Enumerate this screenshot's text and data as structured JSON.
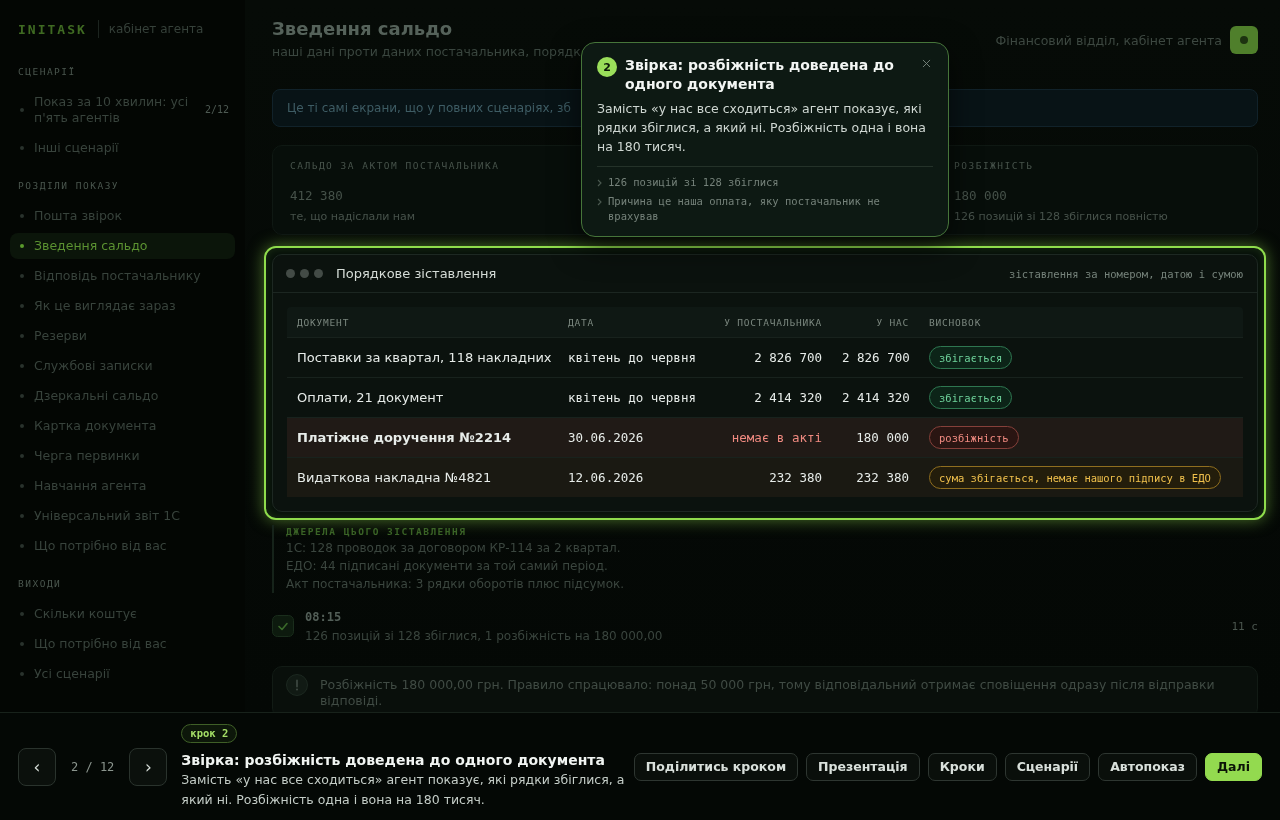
{
  "sidebar": {
    "logo": "INITASK",
    "subtitle": "кабінет агента",
    "sections": [
      {
        "title": "СЦЕНАРІЇ",
        "items": [
          {
            "label": "Показ за 10 хвилин: усі п'ять агентів",
            "count": "2/12",
            "selected": false
          },
          {
            "label": "Інші сценарії",
            "selected": false
          }
        ]
      },
      {
        "title": "РОЗДІЛИ ПОКАЗУ",
        "items": [
          {
            "label": "Пошта звірок",
            "selected": false
          },
          {
            "label": "Зведення сальдо",
            "selected": true
          },
          {
            "label": "Відповідь постачальнику",
            "selected": false
          },
          {
            "label": "Як це виглядає зараз",
            "selected": false
          },
          {
            "label": "Резерви",
            "selected": false
          },
          {
            "label": "Службові записки",
            "selected": false
          },
          {
            "label": "Дзеркальні сальдо",
            "selected": false
          },
          {
            "label": "Картка документа",
            "selected": false
          },
          {
            "label": "Черга первинки",
            "selected": false
          },
          {
            "label": "Навчання агента",
            "selected": false
          },
          {
            "label": "Універсальний звіт 1С",
            "selected": false
          },
          {
            "label": "Що потрібно від вас",
            "selected": false
          }
        ]
      },
      {
        "title": "ВИХОДИ",
        "items": [
          {
            "label": "Скільки коштує",
            "selected": false
          },
          {
            "label": "Що потрібно від вас",
            "selected": false
          },
          {
            "label": "Усі сценарії",
            "selected": false
          }
        ]
      }
    ]
  },
  "header": {
    "title": "Зведення сальдо",
    "subtitle": "наші дані проти даних постачальника, порядк",
    "department": "Фінансовий відділ, кабінет агента"
  },
  "banner": {
    "text": "Це ті самі екрани, що у повних сценаріях, зб"
  },
  "summary": {
    "columns": [
      {
        "label": "САЛЬДО ЗА АКТОМ ПОСТАЧАЛЬНИКА",
        "value": "412 380",
        "note": "те, що надіслали нам"
      },
      {
        "label": "РОЗБІЖНІСТЬ",
        "value": "180 000",
        "note": "126 позицій зі 128 збіглися повністю"
      }
    ]
  },
  "comparison": {
    "title": "Порядкове зіставлення",
    "hint": "зіставлення за номером, датою і сумою",
    "columns": [
      "ДОКУМЕНТ",
      "ДАТА",
      "У ПОСТАЧАЛЬНИКА",
      "У НАС",
      "ВИСНОВОК"
    ],
    "rows": [
      {
        "document": "Поставки за квартал, 118 накладних",
        "date": "квітень до червня",
        "supplier": "2 826 700",
        "ours": "2 826 700",
        "conclusion": "збігається",
        "kind": "match"
      },
      {
        "document": "Оплати, 21 документ",
        "date": "квітень до червня",
        "supplier": "2 414 320",
        "ours": "2 414 320",
        "conclusion": "збігається",
        "kind": "match"
      },
      {
        "document": "Платіжне доручення №2214",
        "date": "30.06.2026",
        "supplier": "немає в акті",
        "ours": "180 000",
        "conclusion": "розбіжність",
        "kind": "mismatch"
      },
      {
        "document": "Видаткова накладна №4821",
        "date": "12.06.2026",
        "supplier": "232 380",
        "ours": "232 380",
        "conclusion": "сума збігається, немає нашого підпису в ЕДО",
        "kind": "warning"
      }
    ]
  },
  "sources": {
    "title": "ДЖЕРЕЛА ЦЬОГО ЗІСТАВЛЕННЯ",
    "lines": [
      "1С: 128 проводок за договором КР-114 за 2 квартал.",
      "ЕДО: 44 підписані документи за той самий період.",
      "Акт постачальника: 3 рядки оборотів плюс підсумок."
    ]
  },
  "timeline": [
    {
      "time": "08:15",
      "text": "126 позицій зі 128 збіглися, 1 розбіжність на 180 000,00",
      "duration": "11 с"
    }
  ],
  "notice": {
    "text": "Розбіжність 180 000,00 грн. Правило спрацювало: понад 50 000 грн, тому відповідальний отримає сповіщення одразу після відправки відповіді."
  },
  "tour_popup": {
    "step": "2",
    "title": "Звірка: розбіжність доведена до одного документа",
    "text": "Замість «у нас все сходиться» агент показує, які рядки збіглися, а який ні. Розбіжність одна і вона на 180 тисяч.",
    "points": [
      "126 позицій зі 128 збіглися",
      "Причина це наша оплата, яку постачальник не врахував"
    ]
  },
  "footer": {
    "prev": "‹",
    "position": "2 / 12",
    "next": "›",
    "step_tag": "крок 2",
    "title": "Звірка: розбіжність доведена до одного документа",
    "text": "Замість «у нас все сходиться» агент показує, які рядки збіглися, а який ні. Розбіжність одна і вона на 180 тисяч.",
    "actions": [
      {
        "label": "Поділитись кроком",
        "kind": "secondary"
      },
      {
        "label": "Презентація",
        "kind": "secondary"
      },
      {
        "label": "Кроки",
        "kind": "secondary"
      },
      {
        "label": "Сценарії",
        "kind": "secondary"
      },
      {
        "label": "Автопоказ",
        "kind": "secondary"
      },
      {
        "label": "Далі",
        "kind": "primary"
      }
    ]
  }
}
